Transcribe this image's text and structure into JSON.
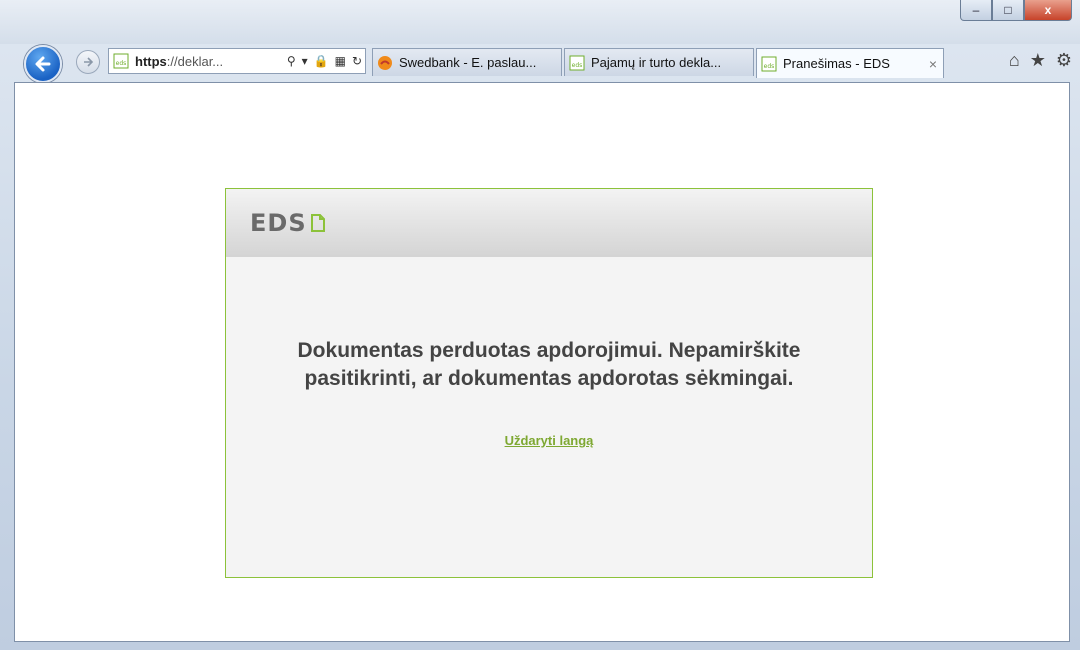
{
  "window": {
    "controls": {
      "minimize": "–",
      "maximize": "□",
      "close": "x"
    }
  },
  "navbar": {
    "address": {
      "scheme": "https",
      "rest": "://deklar..."
    },
    "tabs": [
      {
        "label": "Swedbank - E. paslau...",
        "icon": "swedbank-favicon"
      },
      {
        "label": "Pajamų ir turto dekla...",
        "icon": "eds-favicon"
      },
      {
        "label": "Pranešimas - EDS",
        "icon": "eds-favicon",
        "active": true,
        "close": "×"
      }
    ],
    "right_icons": [
      "home-icon",
      "star-icon",
      "gear-icon"
    ]
  },
  "panel": {
    "logo_text": "EDS",
    "message": "Dokumentas perduotas apdorojimui. Nepamirškite pasitikrinti, ar dokumentas apdorotas sėkmingai.",
    "close_link": "Uždaryti langą"
  },
  "colors": {
    "accent_green": "#8cc23a",
    "link_green": "#7ea832",
    "ie_blue": "#1a62c4"
  }
}
